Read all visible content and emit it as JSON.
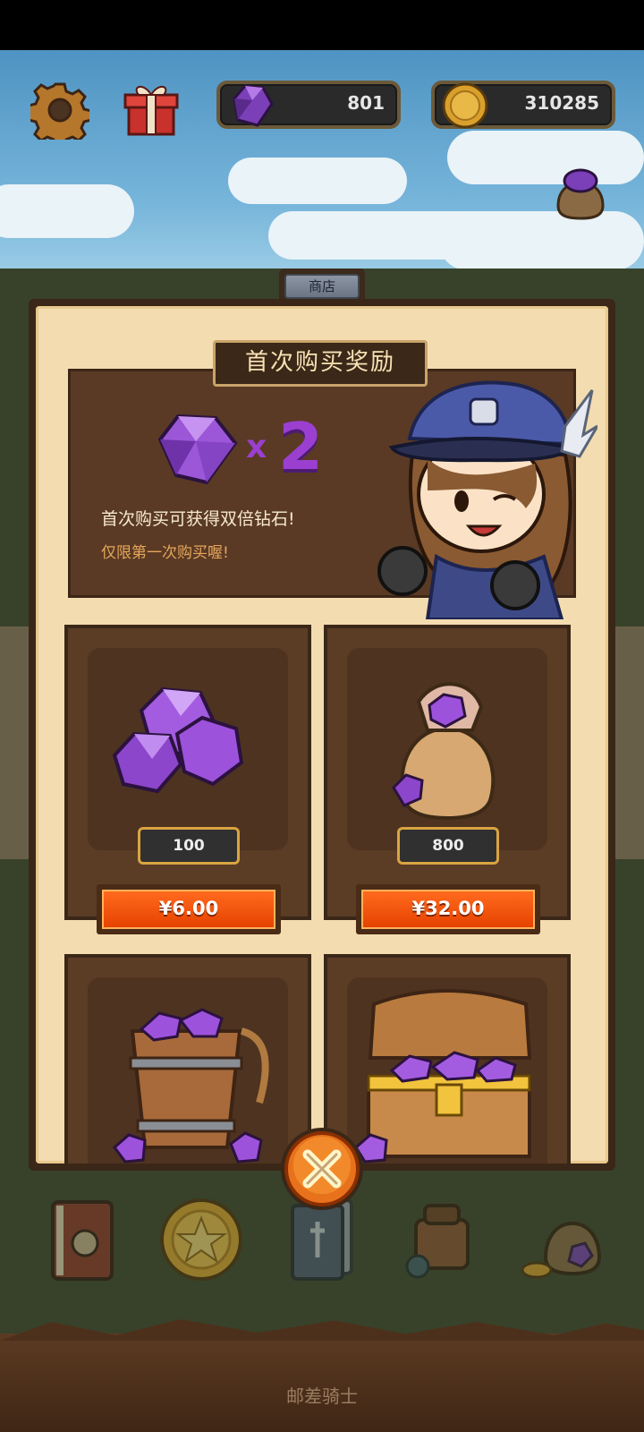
{
  "hud": {
    "gems": "801",
    "coins": "310285"
  },
  "shop": {
    "tab_label": "商店",
    "promo": {
      "title": "首次购买奖励",
      "multiplier_x": "x",
      "multiplier_num": "2",
      "line1": "首次购买可获得双倍钻石!",
      "line2": "仅限第一次购买喔!"
    },
    "items": [
      {
        "quantity": "100",
        "price": "¥6.00"
      },
      {
        "quantity": "800",
        "price": "¥32.00"
      }
    ]
  },
  "footer": {
    "game_title": "邮差骑士"
  },
  "colors": {
    "gem_purple": "#9b3fd1",
    "price_orange": "#ff6a1e",
    "panel_cream": "#f3dcb0",
    "panel_brown": "#5b3c25"
  },
  "icons": [
    "gear-icon",
    "gift-icon",
    "gem-icon",
    "coin-icon",
    "sack-icon",
    "close-icon",
    "book-icon",
    "star-coin-icon",
    "card-icon",
    "bag-icon",
    "treasure-icon"
  ]
}
